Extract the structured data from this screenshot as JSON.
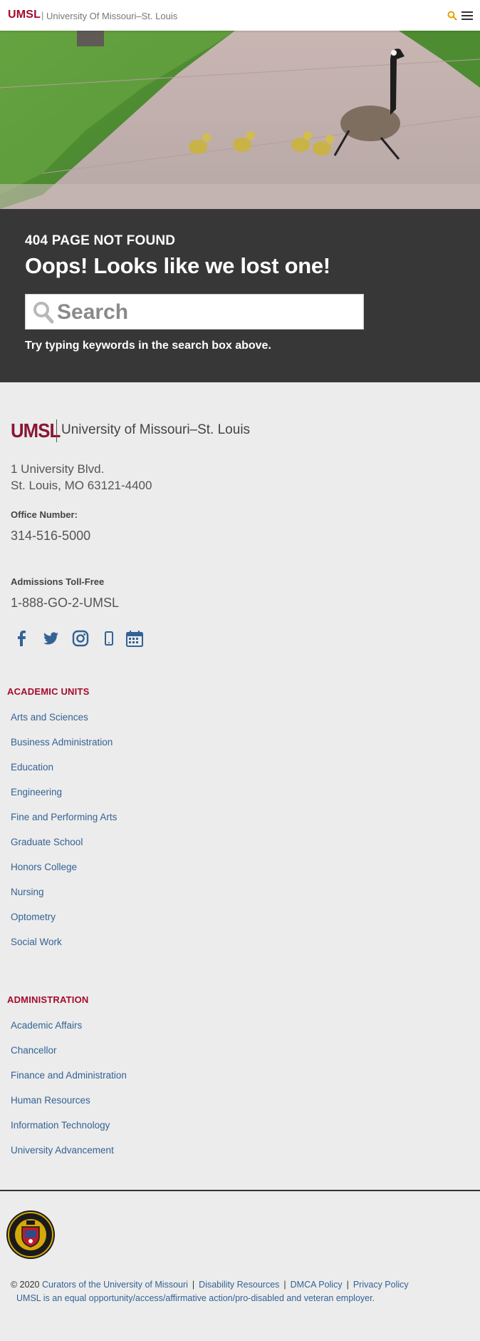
{
  "header": {
    "brand": "UMSL",
    "separator": "|",
    "subtitle": "University Of Missouri–St. Louis",
    "search_icon": "search-icon",
    "menu_icon": "hamburger-menu-icon",
    "accent": "#a50a2e"
  },
  "hero": {
    "icon": "geese-crossing-photo"
  },
  "error": {
    "code": "404 PAGE NOT FOUND",
    "title": "Oops! Looks like we lost one!",
    "search_placeholder": "Search",
    "search_value": "",
    "hint": "Try typing keywords in the search box above."
  },
  "footer": {
    "logo_mark": "UMSL",
    "logo_text": "University of Missouri–St. Louis",
    "address_line1": "1 University Blvd.",
    "address_line2": "St. Louis, MO 63121-4400",
    "office_label": "Office Number:",
    "office_number": "314-516-5000",
    "admissions_label": "Admissions Toll-Free",
    "admissions_number": "1-888-GO-2-UMSL",
    "social": [
      "facebook-icon",
      "twitter-icon",
      "instagram-icon",
      "mobile-icon",
      "calendar-icon"
    ],
    "social_color": "#336295",
    "academic_heading": "ACADEMIC UNITS",
    "academic_units": [
      "Arts and Sciences",
      "Business Administration",
      "Education",
      "Engineering",
      "Fine and Performing Arts",
      "Graduate School",
      "Honors College",
      "Nursing",
      "Optometry",
      "Social Work"
    ],
    "admin_heading": "ADMINISTRATION",
    "administration": [
      "Academic Affairs",
      "Chancellor",
      "Finance and Administration",
      "Human Resources",
      "Information Technology",
      "University Advancement"
    ],
    "seal_icon": "university-seal-icon",
    "copyright_prefix": "© 2020",
    "links": [
      "Curators of the University of Missouri",
      "Disability Resources",
      "DMCA Policy",
      "Privacy Policy"
    ],
    "pipe": "|",
    "eoe": "UMSL is an equal opportunity/access/affirmative action/pro-disabled and veteran employer.",
    "link_color": "#336295"
  }
}
